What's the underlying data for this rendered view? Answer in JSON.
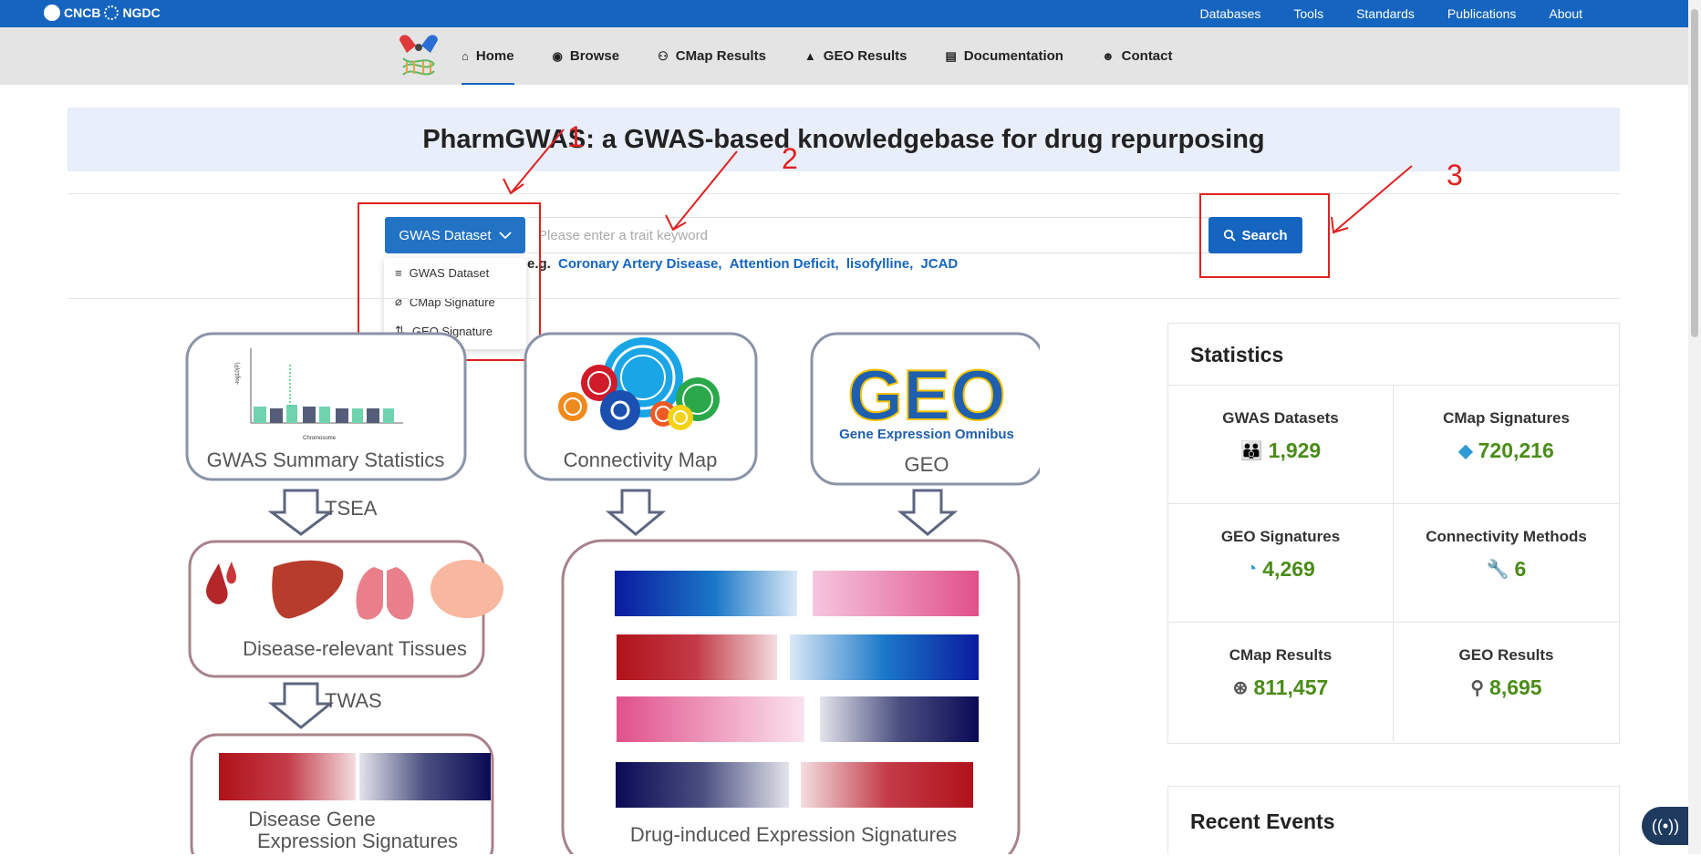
{
  "topbar": {
    "brand1": "CNCB",
    "brand2": "NGDC",
    "links": [
      "Databases",
      "Tools",
      "Standards",
      "Publications",
      "About"
    ]
  },
  "nav": {
    "items": [
      {
        "label": "Home",
        "icon": "home-icon"
      },
      {
        "label": "Browse",
        "icon": "eye-icon"
      },
      {
        "label": "CMap Results",
        "icon": "binoculars-icon"
      },
      {
        "label": "GEO Results",
        "icon": "mountain-icon"
      },
      {
        "label": "Documentation",
        "icon": "document-icon"
      },
      {
        "label": "Contact",
        "icon": "contact-icon"
      }
    ],
    "active": "Home"
  },
  "hero": {
    "title": "PharmGWAS: a GWAS-based knowledgebase for drug repurposing"
  },
  "search": {
    "dropdown_label": "GWAS Dataset",
    "placeholder": "Please enter a trait keyword",
    "button_label": "Search",
    "options": [
      "GWAS Dataset",
      "CMap Signature",
      "GEO Signature"
    ],
    "examples_prefix": "e.g.",
    "examples": [
      "Coronary Artery Disease,",
      "Attention Deficit,",
      "lisofylline,",
      "JCAD"
    ]
  },
  "annotations": {
    "n1": "1",
    "n2": "2",
    "n3": "3"
  },
  "diagram": {
    "gwas_label": "GWAS Summary Statistics",
    "cmap_label": "Connectivity Map",
    "geo_label": "GEO",
    "geo_logo": "GEO",
    "geo_logo_sub": "Gene Expression Omnibus",
    "tsea": "TSEA",
    "twas": "TWAS",
    "tissues_label": "Disease-relevant Tissues",
    "disease_gene_line1": "Disease Gene",
    "disease_gene_line2": "Expression Signatures",
    "drug_label": "Drug-induced Expression Signatures",
    "manhattan_xlabel": "Chromosome",
    "manhattan_ylabel": "-log10(P)"
  },
  "stats": {
    "title": "Statistics",
    "items": [
      {
        "label": "GWAS Datasets",
        "value": "1,929",
        "icon": "people-icon"
      },
      {
        "label": "CMap Signatures",
        "value": "720,216",
        "icon": "pill-icon"
      },
      {
        "label": "GEO Signatures",
        "value": "4,269",
        "icon": "chart-icon"
      },
      {
        "label": "Connectivity Methods",
        "value": "6",
        "icon": "wrench-icon"
      },
      {
        "label": "CMap Results",
        "value": "811,457",
        "icon": "circles-icon"
      },
      {
        "label": "GEO Results",
        "value": "8,695",
        "icon": "search-person-icon"
      }
    ]
  },
  "events": {
    "title": "Recent Events"
  }
}
